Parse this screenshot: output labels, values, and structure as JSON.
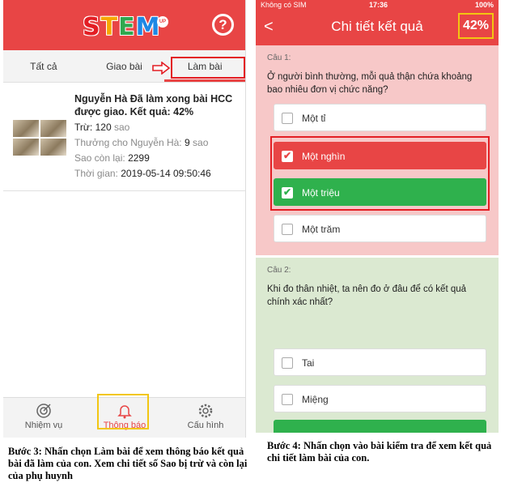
{
  "left": {
    "logo_letters": [
      "S",
      "T",
      "E",
      "M"
    ],
    "logo_badge": "UP",
    "help": "?",
    "tabs": [
      {
        "label": "Tất cả"
      },
      {
        "label": "Giao bài"
      },
      {
        "label": "Làm bài"
      }
    ],
    "card": {
      "title": "Nguyễn Hà Đã làm xong bài HCC được giao. Kết quả: 42%",
      "deduct_label": "Trừ:",
      "deduct_value": "120",
      "deduct_unit": "sao",
      "reward_label": "Thưởng cho Nguyễn Hà:",
      "reward_value": "9",
      "reward_unit": "sao",
      "remain_label": "Sao còn lại:",
      "remain_value": "2299",
      "time_label": "Thời gian:",
      "time_value": "2019-05-14 09:50:46"
    },
    "nav": [
      {
        "label": "Nhiệm vụ",
        "icon": "target-icon"
      },
      {
        "label": "Thông báo",
        "icon": "bell-icon"
      },
      {
        "label": "Cấu hình",
        "icon": "gear-icon"
      }
    ],
    "caption": "Bước 3: Nhấn chọn Làm bài để xem thông báo kết quả bài đã làm của con. Xem chi tiết số  Sao  bị trừ và còn lại của phụ huynh"
  },
  "right": {
    "status": {
      "carrier": "Không có SIM",
      "time": "17:36",
      "battery": "100%"
    },
    "back": "<",
    "title": "Chi tiết kết quả",
    "score": "42%",
    "q1": {
      "label": "Câu 1:",
      "text": "Ở người bình thường, mỗi quả thận chứa khoảng bao nhiêu đơn vị chức năng?",
      "options": [
        "Một tỉ",
        "Một nghìn",
        "Một triệu",
        "Một trăm"
      ]
    },
    "q2": {
      "label": "Câu 2:",
      "text": "Khi đo thân nhiệt, ta nên đo ở đâu để có kết quả chính xác nhất?",
      "options": [
        "Tai",
        "Miệng"
      ]
    },
    "caption": "Bước 4: Nhấn chọn vào bài kiểm tra để xem kết quả chi tiết làm bài của con."
  },
  "colors": {
    "header_red": "#e84545",
    "correct_green": "#2fb14d",
    "highlight_yellow": "#f2c611",
    "q1_bg": "#f7c8c8",
    "q2_bg": "#dbe9d1"
  }
}
